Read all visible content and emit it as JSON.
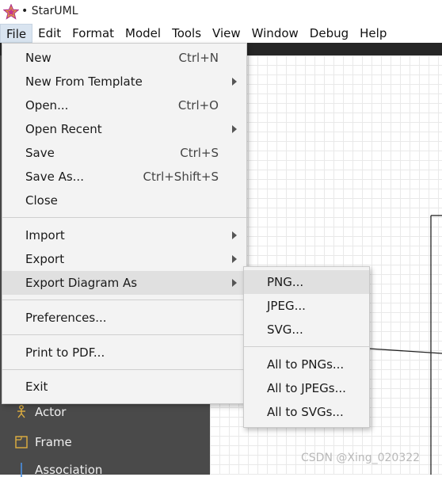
{
  "window": {
    "title": "• StarUML",
    "app_icon": "staruml-star-icon"
  },
  "menubar": {
    "items": [
      {
        "label": "File",
        "active": true
      },
      {
        "label": "Edit"
      },
      {
        "label": "Format"
      },
      {
        "label": "Model"
      },
      {
        "label": "Tools"
      },
      {
        "label": "View"
      },
      {
        "label": "Window"
      },
      {
        "label": "Debug"
      },
      {
        "label": "Help"
      }
    ]
  },
  "file_menu": {
    "items": [
      {
        "label": "New",
        "shortcut": "Ctrl+N"
      },
      {
        "label": "New From Template",
        "submenu": true
      },
      {
        "label": "Open...",
        "shortcut": "Ctrl+O"
      },
      {
        "label": "Open Recent",
        "submenu": true
      },
      {
        "label": "Save",
        "shortcut": "Ctrl+S"
      },
      {
        "label": "Save As...",
        "shortcut": "Ctrl+Shift+S"
      },
      {
        "label": "Close"
      },
      {
        "label": "Import",
        "submenu": true
      },
      {
        "label": "Export",
        "submenu": true
      },
      {
        "label": "Export Diagram As",
        "submenu": true,
        "highlighted": true
      },
      {
        "label": "Preferences..."
      },
      {
        "label": "Print to PDF..."
      },
      {
        "label": "Exit"
      }
    ]
  },
  "export_submenu": {
    "items": [
      {
        "label": "PNG...",
        "highlighted": true
      },
      {
        "label": "JPEG..."
      },
      {
        "label": "SVG..."
      },
      {
        "label": "All to PNGs..."
      },
      {
        "label": "All to JPEGs..."
      },
      {
        "label": "All to SVGs..."
      }
    ]
  },
  "palette": {
    "items": [
      {
        "label": "Actor",
        "icon": "actor-icon"
      },
      {
        "label": "Frame",
        "icon": "frame-icon"
      },
      {
        "label": "Association",
        "icon": "association-icon"
      }
    ]
  },
  "watermark": "CSDN @Xing_020322"
}
